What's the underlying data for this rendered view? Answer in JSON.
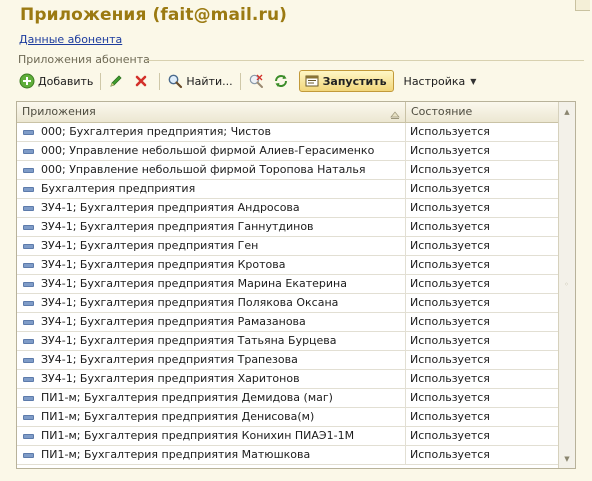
{
  "window": {
    "title": "Приложения (fait@mail.ru)"
  },
  "subscriber_link": "Данные абонента",
  "group": {
    "caption": "Приложения абонента"
  },
  "toolbar": {
    "add_label": "Добавить",
    "find_label": "Найти...",
    "run_label": "Запустить",
    "settings_label": "Настройка"
  },
  "table": {
    "columns": [
      "Приложения",
      "Состояние"
    ],
    "rows": [
      {
        "name": "000; Бухгалтерия предприятия; Чистов",
        "status": "Используется"
      },
      {
        "name": "000; Управление небольшой фирмой Алиев-Герасименко",
        "status": "Используется"
      },
      {
        "name": "000; Управление небольшой фирмой Торопова Наталья",
        "status": "Используется"
      },
      {
        "name": "Бухгалтерия предприятия",
        "status": "Используется"
      },
      {
        "name": "ЗУ4-1; Бухгалтерия предприятия Андросова",
        "status": "Используется"
      },
      {
        "name": "ЗУ4-1; Бухгалтерия предприятия Ганнутдинов",
        "status": "Используется"
      },
      {
        "name": "ЗУ4-1; Бухгалтерия предприятия Ген",
        "status": "Используется"
      },
      {
        "name": "ЗУ4-1; Бухгалтерия предприятия Кротова",
        "status": "Используется"
      },
      {
        "name": "ЗУ4-1; Бухгалтерия предприятия Марина Екатерина",
        "status": "Используется"
      },
      {
        "name": "ЗУ4-1; Бухгалтерия предприятия Полякова Оксана",
        "status": "Используется"
      },
      {
        "name": "ЗУ4-1; Бухгалтерия предприятия Рамазанова",
        "status": "Используется"
      },
      {
        "name": "ЗУ4-1; Бухгалтерия предприятия Татьяна Бурцева",
        "status": "Используется"
      },
      {
        "name": "ЗУ4-1; Бухгалтерия предприятия Трапезова",
        "status": "Используется"
      },
      {
        "name": "ЗУ4-1; Бухгалтерия предприятия Харитонов",
        "status": "Используется"
      },
      {
        "name": "ПИ1-м; Бухгалтерия предприятия Демидова (маг)",
        "status": "Используется"
      },
      {
        "name": "ПИ1-м; Бухгалтерия предприятия Денисова(м)",
        "status": "Используется"
      },
      {
        "name": "ПИ1-м; Бухгалтерия предприятия Конихин ПИАЭ1-1М",
        "status": "Используется"
      },
      {
        "name": "ПИ1-м; Бухгалтерия предприятия Матюшкова",
        "status": "Используется"
      }
    ]
  },
  "icons": {
    "add": "plus-circle-icon",
    "edit": "pencil-icon",
    "delete": "red-cross-icon",
    "find": "magnifier-icon",
    "clear_find": "magnifier-clear-icon",
    "refresh": "refresh-arrows-icon",
    "run": "run-window-icon",
    "dropdown": "triangle-down-icon",
    "sort": "sort-icon",
    "row": "row-marker-icon"
  },
  "colors": {
    "title": "#9b7a12",
    "link": "#1d3c9e",
    "background": "#fbf8e8",
    "run_button": "#f2d67a"
  }
}
